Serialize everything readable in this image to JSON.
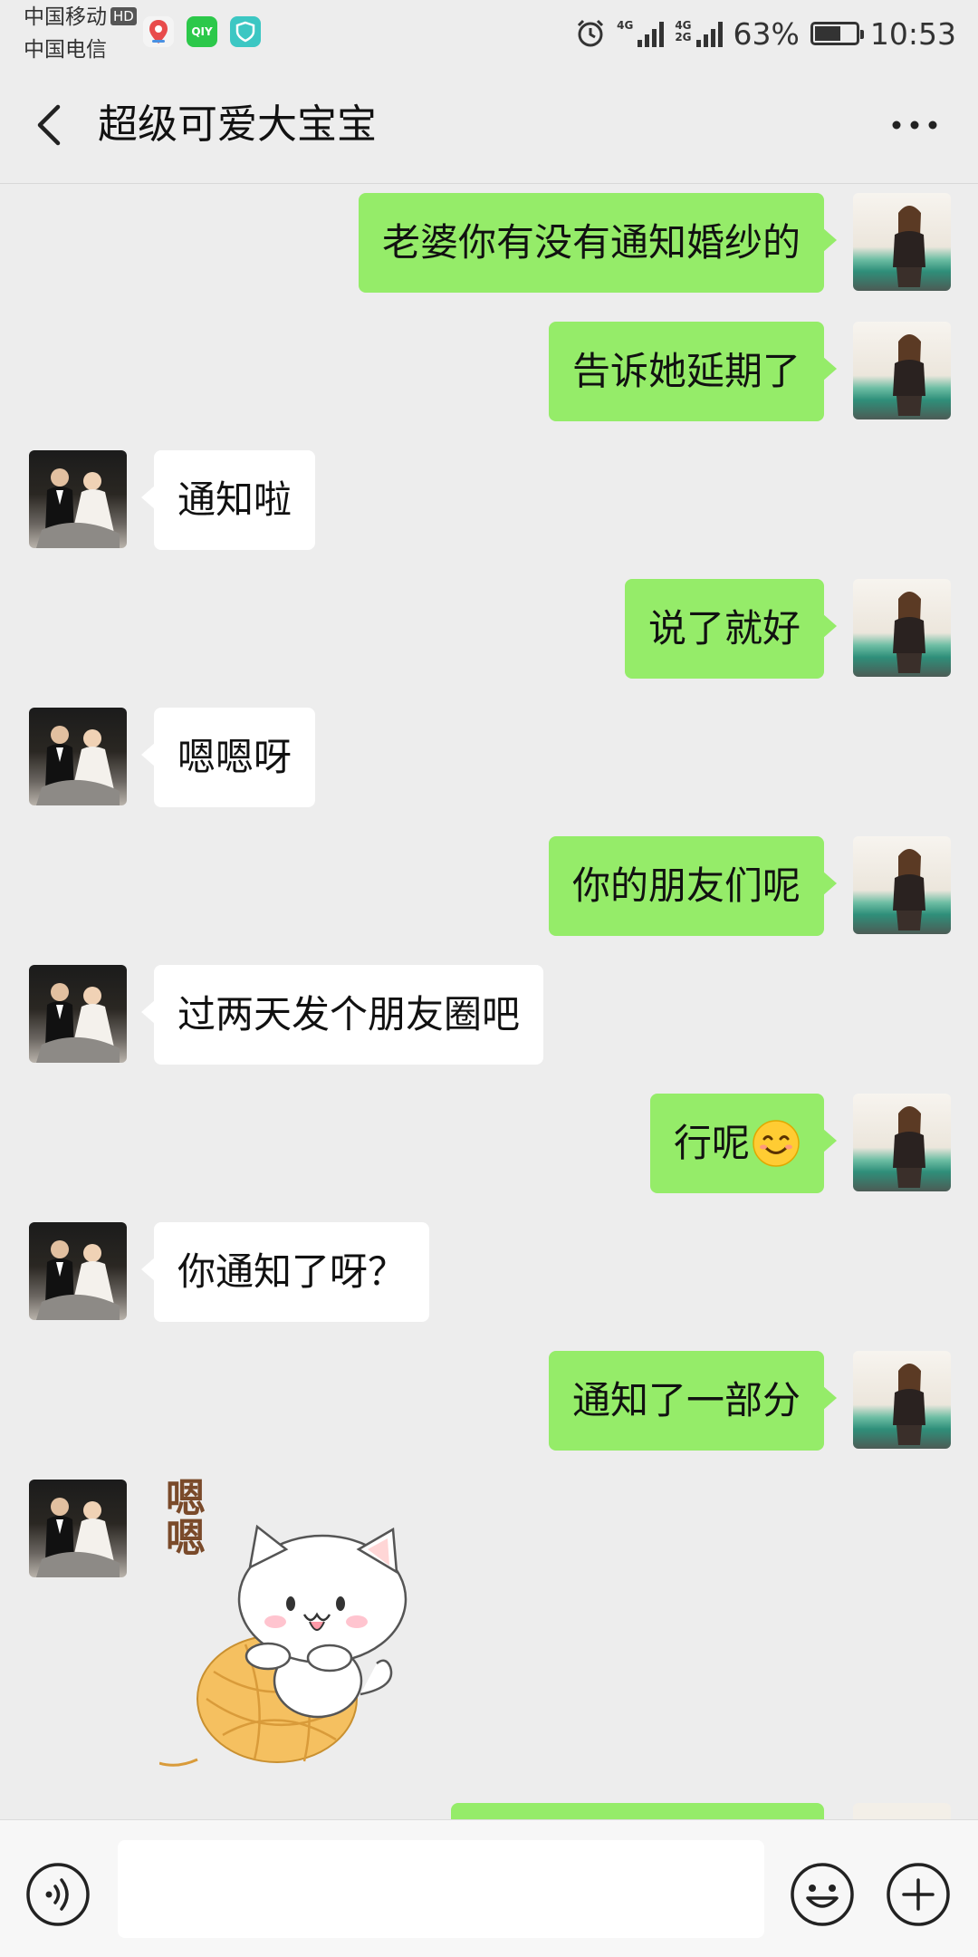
{
  "status_bar": {
    "carrier_1": "中国移动",
    "carrier_1_badge": "HD",
    "carrier_2": "中国电信",
    "iqiyi_icon_text": "QIY",
    "net_1": "4G",
    "net_2": "4G",
    "net_3": "2G",
    "battery_percent": "63%",
    "battery_level": 0.63,
    "time": "10:53",
    "icons": [
      "map-pin-icon",
      "iqiyi-icon",
      "shield-icon",
      "alarm-icon",
      "signal-icon",
      "battery-icon"
    ]
  },
  "header": {
    "title": "超级可爱大宝宝",
    "back_icon": "chevron-left-icon",
    "more_label": "···"
  },
  "messages": [
    {
      "from": "self",
      "text": "老婆你有没有通知婚纱的"
    },
    {
      "from": "self",
      "text": "告诉她延期了"
    },
    {
      "from": "other",
      "text": "通知啦"
    },
    {
      "from": "self",
      "text": "说了就好"
    },
    {
      "from": "other",
      "text": "嗯嗯呀"
    },
    {
      "from": "self",
      "text": "你的朋友们呢"
    },
    {
      "from": "other",
      "text": "过两天发个朋友圈吧"
    },
    {
      "from": "self",
      "text": "行呢",
      "emoji": "smiling-face-emoji"
    },
    {
      "from": "other",
      "text": "你通知了呀？"
    },
    {
      "from": "self",
      "text": "通知了一部分"
    }
  ],
  "sticker": {
    "from": "other",
    "text": "嗯嗯",
    "description": "cat-on-yarn-ball-sticker"
  },
  "input_bar": {
    "voice_icon": "voice-icon",
    "input_value": "",
    "emoji_icon": "emoji-icon",
    "plus_icon": "plus-icon"
  },
  "colors": {
    "background": "#ededed",
    "self_bubble": "#95ec69",
    "other_bubble": "#ffffff",
    "input_bar": "#f7f7f7"
  }
}
